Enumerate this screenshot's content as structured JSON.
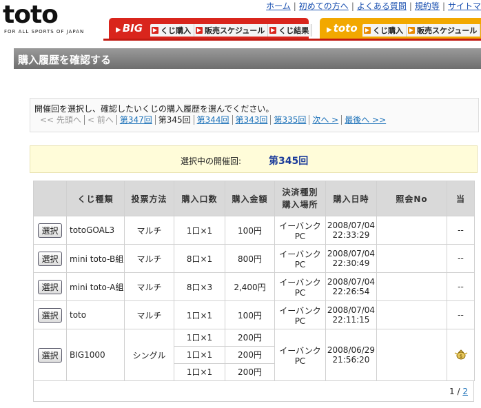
{
  "logo": {
    "text": "toto",
    "tagline": "FOR ALL SPORTS OF JAPAN"
  },
  "toplinks": [
    "ホーム",
    "初めての方へ",
    "よくある質問",
    "規約等",
    "サイトマ"
  ],
  "tabs": {
    "big": {
      "title": "BIG",
      "items": [
        "くじ購入",
        "販売スケジュール",
        "くじ結果"
      ]
    },
    "toto": {
      "title": "toto",
      "items": [
        "くじ購入",
        "販売スケジュール"
      ]
    }
  },
  "page_title": "購入履歴を確認する",
  "selection": {
    "instruction": "開催回を選択し、確認したいくじの購入履歴を選んでください。",
    "nav": [
      {
        "label": "<< 先頭へ",
        "state": "disabled"
      },
      {
        "label": "< 前へ",
        "state": "disabled"
      },
      {
        "label": "第347回",
        "state": "link"
      },
      {
        "label": "第345回",
        "state": "current"
      },
      {
        "label": "第344回",
        "state": "link"
      },
      {
        "label": "第343回",
        "state": "link"
      },
      {
        "label": "第335回",
        "state": "link"
      },
      {
        "label": "次へ >",
        "state": "link"
      },
      {
        "label": "最後へ >>",
        "state": "link"
      }
    ]
  },
  "selected_round": {
    "label": "選択中の開催回:",
    "value": "第345回"
  },
  "table": {
    "headers": [
      "",
      "くじ種類",
      "投票方法",
      "購入口数",
      "購入金額",
      "決済種別\n購入場所",
      "購入日時",
      "照会No",
      "当"
    ],
    "select_label": "選択",
    "rows": [
      {
        "kind": "totoGOAL3",
        "method": "マルチ",
        "count": "1口×1",
        "amount": "100円",
        "payment": "イーバンク",
        "place": "PC",
        "date": "2008/07/04",
        "time": "22:33:29",
        "ref": "",
        "result": "--"
      },
      {
        "kind": "mini toto-B組",
        "method": "マルチ",
        "count": "8口×1",
        "amount": "800円",
        "payment": "イーバンク",
        "place": "PC",
        "date": "2008/07/04",
        "time": "22:30:49",
        "ref": "",
        "result": "--"
      },
      {
        "kind": "mini toto-A組",
        "method": "マルチ",
        "count": "8口×3",
        "amount": "2,400円",
        "payment": "イーバンク",
        "place": "PC",
        "date": "2008/07/04",
        "time": "22:26:54",
        "ref": "",
        "result": "--"
      },
      {
        "kind": "toto",
        "method": "マルチ",
        "count": "1口×1",
        "amount": "100円",
        "payment": "イーバンク",
        "place": "PC",
        "date": "2008/07/04",
        "time": "22:11:15",
        "ref": "",
        "result": "--"
      }
    ],
    "big_row": {
      "kind": "BIG1000",
      "method": "シングル",
      "lines": [
        {
          "count": "1口×1",
          "amount": "200円"
        },
        {
          "count": "1口×1",
          "amount": "200円"
        },
        {
          "count": "1口×1",
          "amount": "200円"
        }
      ],
      "payment": "イーバンク",
      "place": "PC",
      "date": "2008/06/29",
      "time": "21:56:20",
      "ref": "",
      "result_icon": "money-bag-icon"
    }
  },
  "pager": {
    "current": "1",
    "sep": " / ",
    "total": "2"
  }
}
